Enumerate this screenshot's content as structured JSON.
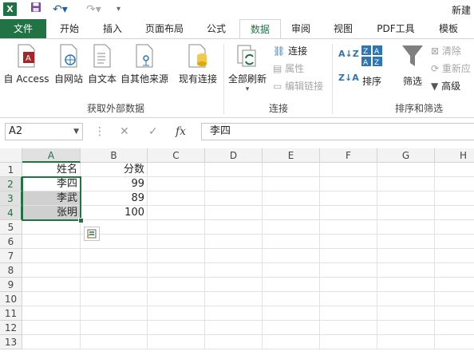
{
  "qat": {
    "logo": "X",
    "title": "新建"
  },
  "tabs": [
    "文件",
    "开始",
    "插入",
    "页面布局",
    "公式",
    "数据",
    "审阅",
    "视图",
    "PDF工具",
    "模板"
  ],
  "ribbon": {
    "get_external": {
      "items": [
        "自 Access",
        "自网站",
        "自文本",
        "自其他来源"
      ],
      "label": "获取外部数据"
    },
    "existing_conn": "现有连接",
    "refresh_all": "全部刷新",
    "connections": {
      "items": [
        "连接",
        "属性",
        "编辑链接"
      ],
      "label": "连接"
    },
    "sort": "排序",
    "filter": "筛选",
    "sort_filter": {
      "items": [
        "清除",
        "重新应",
        "高级"
      ],
      "label": "排序和筛选"
    }
  },
  "formula_bar": {
    "name_box": "A2",
    "fx": "fx",
    "value": "李四"
  },
  "grid": {
    "columns": [
      "A",
      "B",
      "C",
      "D",
      "E",
      "F",
      "G",
      "H"
    ],
    "rows": [
      "1",
      "2",
      "3",
      "4",
      "5",
      "6",
      "7",
      "8",
      "9",
      "10",
      "11",
      "12",
      "13"
    ],
    "cells": [
      [
        "姓名",
        "分数"
      ],
      [
        "李四",
        "99"
      ],
      [
        "李武",
        "89"
      ],
      [
        "张明",
        "100"
      ]
    ]
  },
  "colors": {
    "accent": "#217346",
    "selection": "#d0d0d0"
  }
}
